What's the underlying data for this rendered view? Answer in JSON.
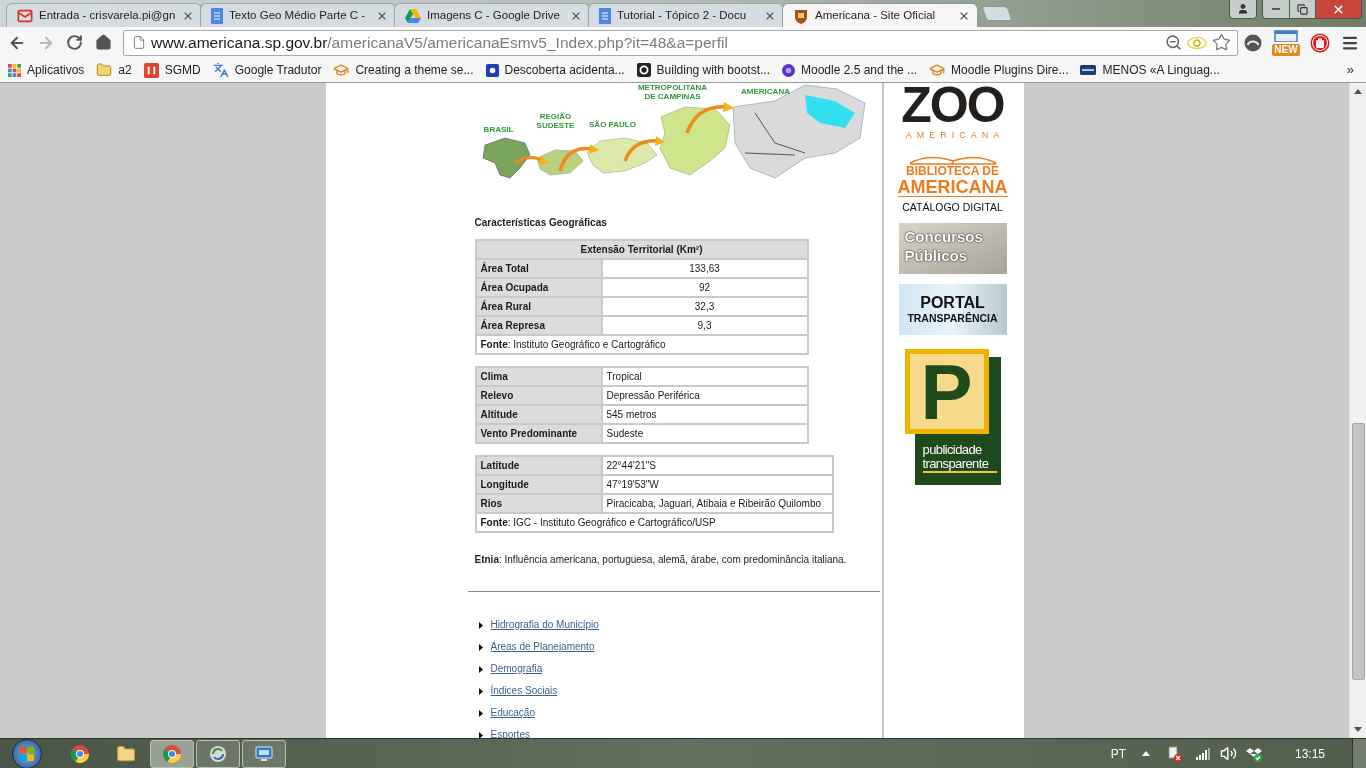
{
  "tabs": [
    {
      "title": "Entrada - crisvarela.pi@gn",
      "selected": false
    },
    {
      "title": "Texto Geo Médio Parte C -",
      "selected": false
    },
    {
      "title": "Imagens C - Google Drive",
      "selected": false
    },
    {
      "title": "Tutorial - Tópico 2 - Docu",
      "selected": false
    },
    {
      "title": "Americana - Site Oficial",
      "selected": true
    }
  ],
  "address_bar": {
    "host": "www.americana.sp.gov.br",
    "path": "/americanaV5/americanaEsmv5_Index.php?it=48&a=perfil"
  },
  "extension_badge": "NEW",
  "bookmarks": [
    {
      "label": "Aplicativos"
    },
    {
      "label": "a2"
    },
    {
      "label": "SGMD"
    },
    {
      "label": "Google Tradutor"
    },
    {
      "label": "Creating a theme se..."
    },
    {
      "label": "Descoberta acidenta..."
    },
    {
      "label": "Building with bootst..."
    },
    {
      "label": "Moodle 2.5 and the ..."
    },
    {
      "label": "Moodle Plugins Dire..."
    },
    {
      "label": "MENOS «A Linguag..."
    }
  ],
  "bookmarks_overflow": "»",
  "map": {
    "labels": [
      "BRASIL",
      "REGIÃO SUDESTE",
      "SÃO PAULO",
      "METROPOLITANA DE CAMPINAS",
      "AMERICANA"
    ]
  },
  "section_title": "Características Geográficas",
  "territory_table": {
    "header": "Extensão Territorial (Km²)",
    "rows": [
      {
        "label": "Área Total",
        "value": "133,63"
      },
      {
        "label": "Área Ocupada",
        "value": "92"
      },
      {
        "label": "Área Rural",
        "value": "32,3"
      },
      {
        "label": "Área Represa",
        "value": "9,3"
      }
    ],
    "source": "**Fonte**: Instituto Geográfico e Cartográfico"
  },
  "climate_table": {
    "rows": [
      {
        "label": "Clima",
        "value": "Tropical"
      },
      {
        "label": "Relevo",
        "value": "Depressão Periférica"
      },
      {
        "label": "Altitude",
        "value": "545 metros"
      },
      {
        "label": "Vento Predominante",
        "value": "Sudeste"
      }
    ]
  },
  "location_table": {
    "rows": [
      {
        "label": "Latitude",
        "value": "22°44'21\"S"
      },
      {
        "label": "Longitude",
        "value": "47°19'53\"W"
      },
      {
        "label": "Rios",
        "value": "Piracicaba, Jaguari, Atibaia e Ribeirão Quilombo"
      }
    ],
    "source": "**Fonte**: IGC - Instituto Geográfico e Cartográfico/USP"
  },
  "ethnicity": "**Etnia**: Influência americana, portuguesa, alemã, árabe, com predominância italiana.",
  "links": [
    "Hidrografia do Município",
    "Áreas de Planejamento",
    "Demografia",
    "Índices Sociais",
    "Educação",
    "Esportes"
  ],
  "sidebar": {
    "zoo": {
      "title": "ZOO",
      "subtitle": "AMERICANA"
    },
    "library": {
      "line_1": "BIBLIOTECA DE",
      "line_2": "AMERICANA",
      "line_3": "CATÁLOGO DIGITAL"
    },
    "contests": "Concursos Públicos",
    "transparency_portal": {
      "title": "PORTAL",
      "subtitle": "TRANSPARÊNCIA"
    },
    "publicity": {
      "letter": "P",
      "text": "publicidade transparente"
    }
  },
  "taskbar": {
    "apps": [
      {
        "open": false,
        "selected": false
      },
      {
        "open": false,
        "selected": false
      },
      {
        "open": true,
        "selected": true
      },
      {
        "open": true,
        "selected": false
      },
      {
        "open": true,
        "selected": false
      }
    ],
    "language": "PT",
    "clock": "13:15"
  }
}
